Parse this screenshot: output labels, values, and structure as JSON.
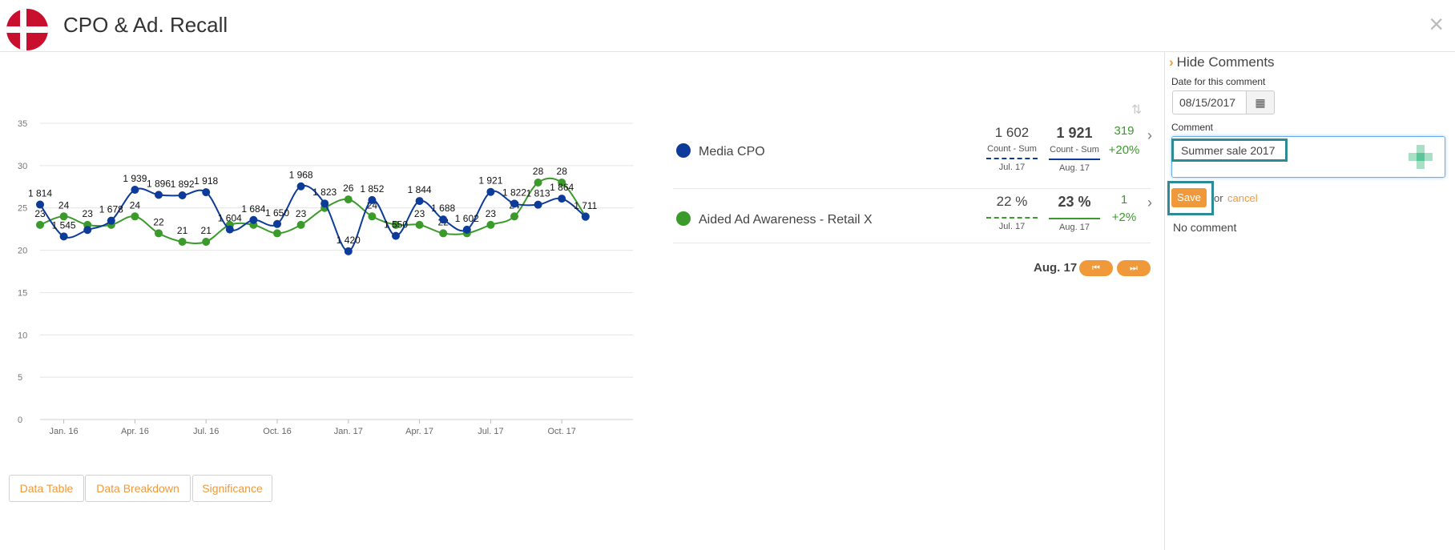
{
  "header": {
    "title": "CPO & Ad. Recall",
    "close_icon": "×"
  },
  "colors": {
    "blue": "#0d3b99",
    "green": "#3a9a2a",
    "accent": "#f0993a",
    "flag_red": "#c8102e"
  },
  "chart_data": {
    "type": "line",
    "x": [
      "2015-12",
      "2016-01",
      "2016-02",
      "2016-03",
      "2016-04",
      "2016-05",
      "2016-06",
      "2016-07",
      "2016-08",
      "2016-09",
      "2016-10",
      "2016-11",
      "2016-12",
      "2017-01",
      "2017-02",
      "2017-03",
      "2017-04",
      "2017-05",
      "2017-06",
      "2017-07",
      "2017-08",
      "2017-09",
      "2017-10",
      "2017-11",
      "2017-12",
      "2018-01"
    ],
    "x_tick_labels": [
      "Jan. 16",
      "Apr. 16",
      "Jul. 16",
      "Oct. 16",
      "Jan. 17",
      "Apr. 17",
      "Jul. 17",
      "Oct. 17"
    ],
    "y_left_ticks": [
      "0",
      "5",
      "10",
      "15",
      "20",
      "25",
      "30",
      "35"
    ],
    "y_left_range": [
      0,
      35
    ],
    "y_right_ticks": [
      "0",
      "500",
      "1K",
      "1 500",
      "2K",
      "2 500"
    ],
    "y_right_range": [
      0,
      2500
    ],
    "grid": true,
    "series": [
      {
        "name": "Media CPO",
        "axis": "right",
        "values": [
          1814,
          1545,
          1600,
          1678,
          1939,
          1896,
          1892,
          1918,
          1604,
          1684,
          1650,
          1968,
          1823,
          1420,
          1852,
          1550,
          1844,
          1688,
          1602,
          1921,
          1822,
          1813,
          1864,
          1711
        ],
        "labels": [
          "1 814",
          "1 545",
          "",
          "1 678",
          "1 939",
          "1 896",
          "1 892",
          "1 918",
          "1 604",
          "1 684",
          "1 650",
          "1 968",
          "1 823",
          "1 420",
          "1 852",
          "1 550",
          "1 844",
          "1 688",
          "1 602",
          "1 921",
          "1 822",
          "1 813",
          "1 864",
          "1 711"
        ]
      },
      {
        "name": "Aided Ad Awareness - Retail X",
        "axis": "left",
        "values": [
          23,
          24,
          23,
          23,
          24,
          22,
          21,
          21,
          23,
          23,
          22,
          23,
          25,
          26,
          24,
          23,
          23,
          22,
          22,
          23,
          24,
          28,
          28,
          24
        ],
        "labels": [
          "23",
          "24",
          "23",
          "",
          "24",
          "22",
          "21",
          "21",
          "",
          "",
          "",
          "23",
          "",
          "26",
          "24",
          "",
          "23",
          "22",
          "",
          "23",
          "24",
          "28",
          "28",
          ""
        ]
      }
    ]
  },
  "legend": {
    "rows": [
      {
        "name": "Media CPO",
        "prev_value": "1 602",
        "prev_sub": "Count - Sum",
        "prev_period": "Jul. 17",
        "curr_value": "1 921",
        "curr_sub": "Count - Sum",
        "curr_period": "Aug. 17",
        "change_abs": "319",
        "change_pct": "+20%"
      },
      {
        "name": "Aided Ad Awareness - Retail X",
        "prev_value": "22 %",
        "prev_period": "Jul. 17",
        "curr_value": "23 %",
        "curr_period": "Aug. 17",
        "change_abs": "1",
        "change_pct": "+2%"
      }
    ]
  },
  "period_nav": {
    "label": "Aug. 17",
    "first_icon": "⏮",
    "last_icon": "⏭"
  },
  "bottom_buttons": [
    "Data Table",
    "Data Breakdown",
    "Significance"
  ],
  "panel": {
    "hide_label": "Hide Comments",
    "date_label": "Date for this comment",
    "date_value": "08/15/2017",
    "comment_label": "Comment",
    "comment_value": "Summer sale 2017",
    "save_label": "Save",
    "or_label": "or",
    "cancel_label": "cancel",
    "no_comment": "No comment"
  }
}
